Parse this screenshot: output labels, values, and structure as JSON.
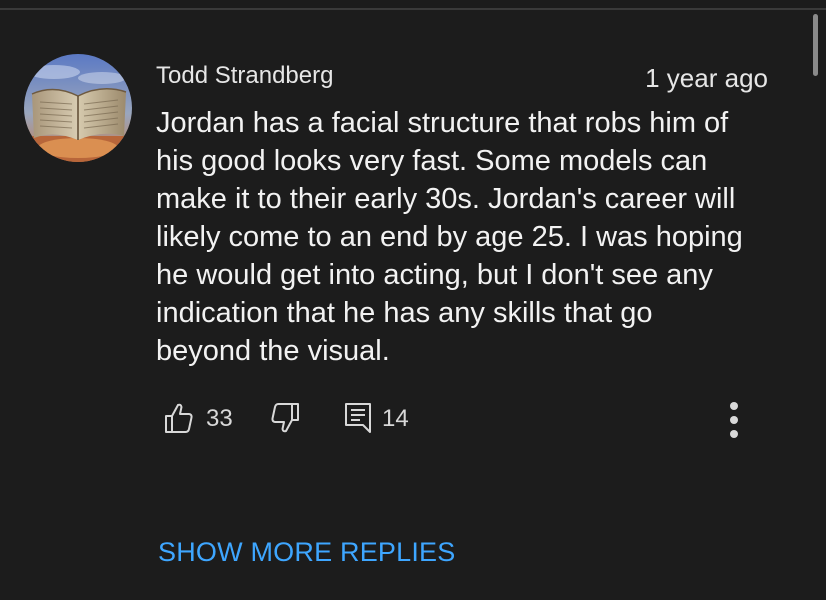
{
  "comment": {
    "author": "Todd Strandberg",
    "timestamp": "1 year ago",
    "avatar_icon": "open-book-avatar",
    "body_lines": [
      "Jordan has a facial structure that robs him of",
      "his good looks very fast. Some models can",
      "make it to their early 30s. Jordan's career will",
      "likely come to an end by age 25. I was hoping",
      "he would get into acting, but I don't see any",
      "indication that he has any skills that go",
      "beyond the visual."
    ],
    "actions": {
      "like_icon": "thumbs-up-icon",
      "like_count": "33",
      "dislike_icon": "thumbs-down-icon",
      "reply_icon": "comment-icon",
      "reply_count": "14",
      "more_icon": "more-vertical-icon"
    }
  },
  "show_more_replies": "SHOW MORE REPLIES",
  "colors": {
    "background": "#1c1c1c",
    "text": "#f2f2f2",
    "link": "#3ea6ff"
  }
}
